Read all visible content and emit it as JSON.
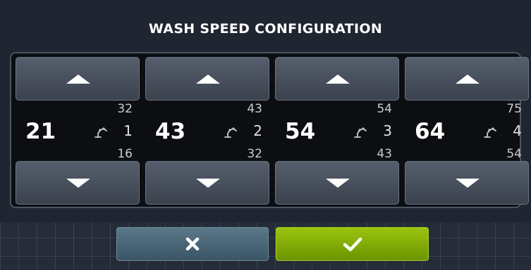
{
  "title": "WASH SPEED CONFIGURATION",
  "robots": [
    {
      "current": "21",
      "max": "32",
      "min": "16",
      "robot_number": "1"
    },
    {
      "current": "43",
      "max": "43",
      "min": "32",
      "robot_number": "2"
    },
    {
      "current": "54",
      "max": "54",
      "min": "43",
      "robot_number": "3"
    },
    {
      "current": "64",
      "max": "75",
      "min": "54",
      "robot_number": "4"
    }
  ],
  "icons": {
    "increase": "triangle-up-icon",
    "decrease": "triangle-down-icon",
    "robot": "robot-arm-icon",
    "cancel": "x-icon",
    "confirm": "check-icon"
  },
  "colors": {
    "cancel_button": "#4a6a7c",
    "confirm_button": "#86b000",
    "background": "#252c37"
  }
}
